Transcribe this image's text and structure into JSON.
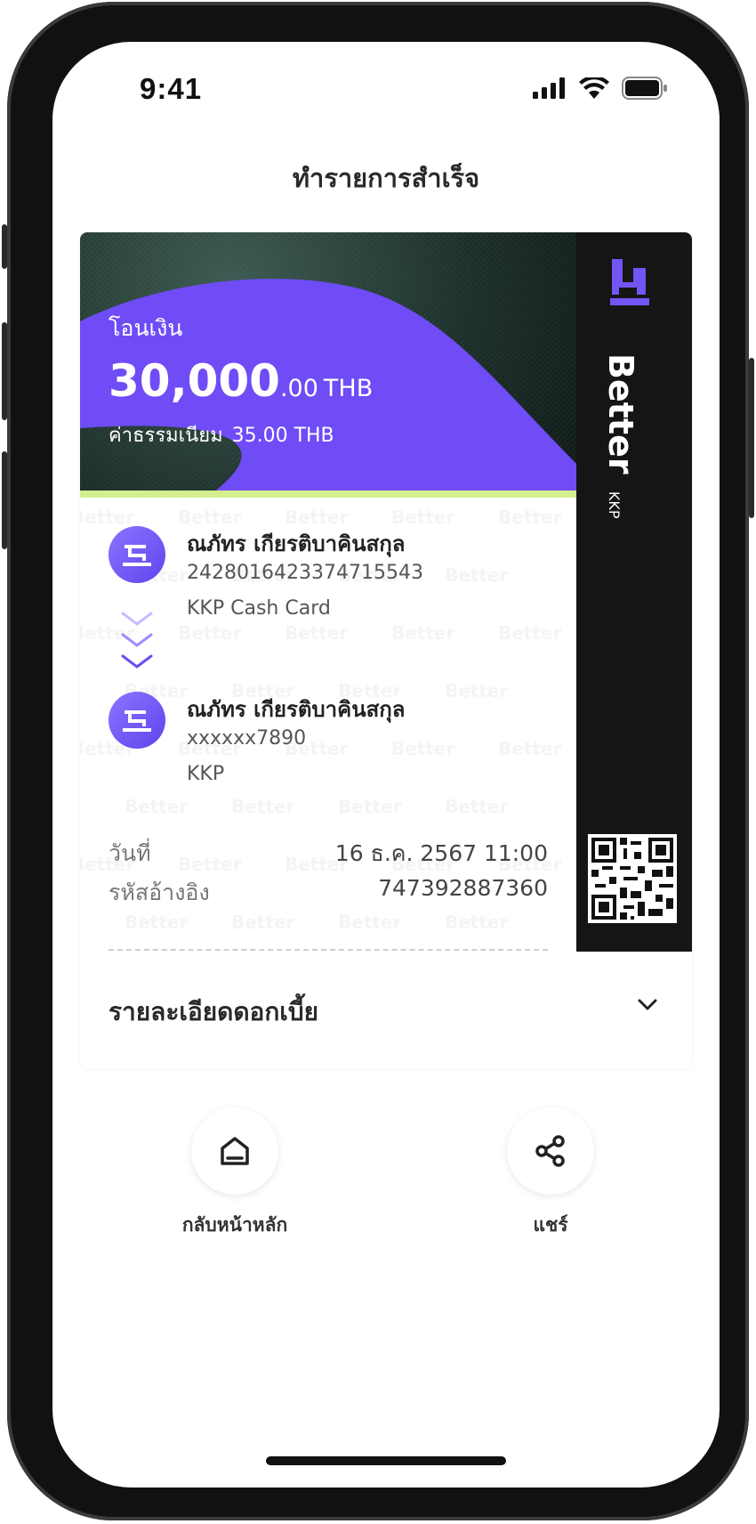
{
  "status": {
    "time": "9:41"
  },
  "page": {
    "title": "ทำรายการสำเร็จ"
  },
  "transfer": {
    "type_label": "โอนเงิน",
    "amount_int": "30,000",
    "amount_dec": ".00",
    "currency": "THB",
    "fee_label": "ค่าธรรมเนียม",
    "fee_value": "35.00 THB"
  },
  "brand": {
    "name": "Better",
    "sub": "KKP",
    "watermark": "Better"
  },
  "from": {
    "name": "ณภัทร เกียรติบาคินสกุล",
    "account": "2428016423374715543",
    "bank": "KKP Cash Card"
  },
  "to": {
    "name": "ณภัทร เกียรติบาคินสกุล",
    "account": "xxxxxx7890",
    "bank": "KKP"
  },
  "details": {
    "date_label": "วันที่",
    "date_value": "16 ธ.ค. 2567 11:00",
    "ref_label": "รหัสอ้างอิง",
    "ref_value": "747392887360"
  },
  "interest": {
    "label": "รายละเอียดดอกเบี้ย"
  },
  "actions": {
    "home_label": "กลับหน้าหลัก",
    "share_label": "แชร์"
  },
  "colors": {
    "accent": "#7354F5",
    "lime": "#D4EF8D",
    "dark": "#151515"
  }
}
